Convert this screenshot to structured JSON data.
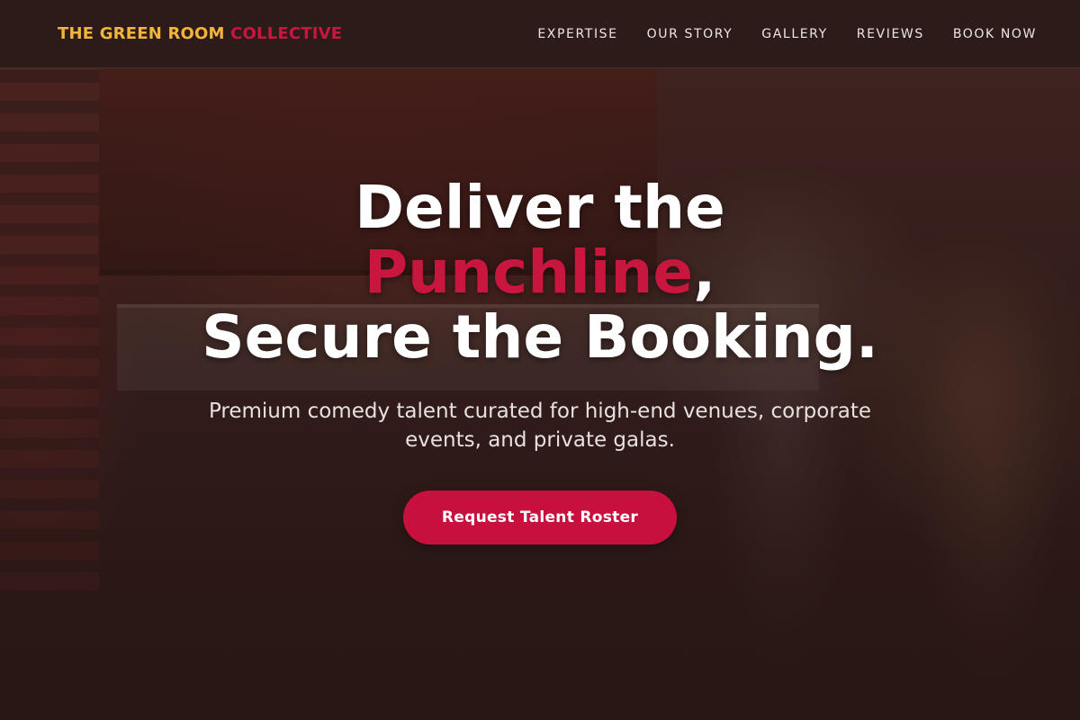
{
  "brand": {
    "part1": "THE GREEN ROOM",
    "part2": "COLLECTIVE",
    "colors": {
      "primary": "#f2b53c",
      "accent": "#c8163f"
    }
  },
  "nav": {
    "items": [
      {
        "label": "EXPERTISE"
      },
      {
        "label": "OUR STORY"
      },
      {
        "label": "GALLERY"
      },
      {
        "label": "REVIEWS"
      },
      {
        "label": "BOOK NOW"
      }
    ]
  },
  "hero": {
    "headline_line1": "Deliver the",
    "headline_accent": "Punchline",
    "headline_comma": ",",
    "headline_line3": "Secure the Booking.",
    "subtitle": "Premium comedy talent curated for high-end venues, corporate events, and private galas.",
    "cta_label": "Request Talent Roster",
    "cta_color": "#c8103e"
  }
}
